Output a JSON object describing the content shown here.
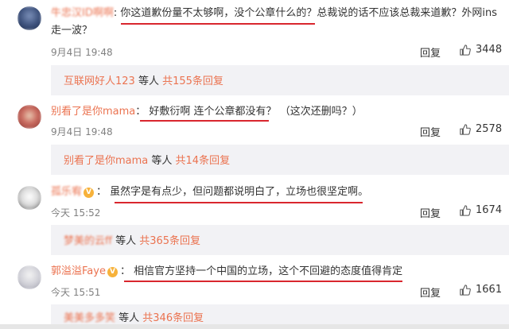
{
  "comments": [
    {
      "username": "牛忠汉ID啊啊",
      "colon": ":",
      "text_a": "你这道歉份量不太够啊，没个公章什么的？",
      "text_b": "总裁说的话不应该总裁来道歉？外网ins",
      "text_c": "走一波？",
      "time": "9月4日 19:48",
      "reply": "回复",
      "likes": "3448",
      "sub_user": "互联网好人123",
      "sub_mid": " 等人 ",
      "sub_count": "共155条回复"
    },
    {
      "username": "别看了是你mama",
      "colon": "：",
      "text_a": "好敷衍啊 连个公章都没有？",
      "text_b": "（这次还删吗？）",
      "time": "9月4日 19:48",
      "reply": "回复",
      "likes": "2578",
      "sub_user": "别看了是你mama",
      "sub_mid": " 等人 ",
      "sub_count": "共14条回复"
    },
    {
      "username": "孤乐宥",
      "colon": "：",
      "text_a": "虽然字是有点少，但问题都说明白了，立场也很坚定啊。",
      "time": "今天 15:52",
      "reply": "回复",
      "likes": "1674",
      "sub_user": "梦美的云ff",
      "sub_mid": " 等人 ",
      "sub_count": "共365条回复"
    },
    {
      "username": "郭溢溢Faye",
      "colon": "：",
      "text_a": "相信官方坚持一个中国的立场，这个不回避的态度值得肯定",
      "time": "今天 15:51",
      "reply": "回复",
      "likes": "1661",
      "sub_user": "美美多多笑",
      "sub_mid": " 等人 ",
      "sub_count": "共346条回复"
    }
  ],
  "colors": {
    "link": "#eb7350",
    "underline": "#d9262e",
    "subBg": "#f2f2f5",
    "meta": "#808080",
    "vBadge": "#f7b23b"
  },
  "icons": [
    "thumbs-up-icon",
    "verified-v-icon"
  ]
}
